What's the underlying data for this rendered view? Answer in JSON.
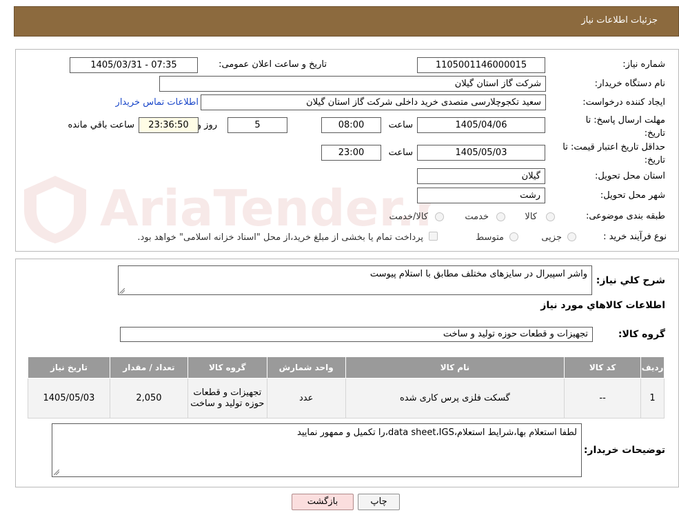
{
  "header": {
    "title": "جزئیات اطلاعات نیاز"
  },
  "watermark": {
    "text": "AriaTender.neT",
    "color": "#c0504d"
  },
  "form": {
    "need_number_label": "شماره نیاز:",
    "need_number": "1105001146000015",
    "announce_label": "تاریخ و ساعت اعلان عمومی:",
    "announce_value": "1405/03/31 - 07:35",
    "buyer_org_label": "نام دستگاه خریدار:",
    "buyer_org": "شرکت گاز استان گیلان",
    "requester_label": "ایجاد کننده درخواست:",
    "requester": "سعید تکجوچلارسی متصدی خرید داخلی شرکت گاز استان گیلان",
    "contact_link": "اطلاعات تماس خریدار",
    "reply_deadline_label": "مهلت ارسال پاسخ: تا تاریخ:",
    "reply_date": "1405/04/06",
    "time_label": "ساعت",
    "reply_time": "08:00",
    "days_value": "5",
    "days_label": "روز و",
    "remaining_time": "23:36:50",
    "remaining_label": "ساعت باقي مانده",
    "price_validity_label": "حداقل تاریخ اعتبار قیمت: تا تاریخ:",
    "price_date": "1405/05/03",
    "price_time": "23:00",
    "province_label": "استان محل تحویل:",
    "province": "گیلان",
    "city_label": "شهر محل تحویل:",
    "city": "رشت",
    "category_label": "طبقه بندی موضوعی:",
    "category_options": [
      "کالا",
      "خدمت",
      "کالا/خدمت"
    ],
    "process_label": "نوع فرآیند خرید :",
    "process_options": [
      "جزیی",
      "متوسط"
    ],
    "payment_note": "پرداخت تمام یا بخشی از مبلغ خرید،از محل \"اسناد خزانه اسلامی\" خواهد بود."
  },
  "details": {
    "summary_label": "شرح کلي نياز:",
    "summary": "واشر اسپیرال در سایزهای مختلف مطابق با استلام پیوست",
    "goods_info_title": "اطلاعات کالاهاي مورد نياز",
    "goods_group_label": "گروه کالا:",
    "goods_group": "تجهیزات و قطعات حوزه تولید و ساخت",
    "table": {
      "headers": [
        "ردیف",
        "کد کالا",
        "نام کالا",
        "واحد شمارش",
        "گروه کالا",
        "تعداد / مقدار",
        "تاریخ نیاز"
      ],
      "rows": [
        [
          "1",
          "--",
          "گسکت فلزی پرس کاری شده",
          "عدد",
          "تجهیزات و قطعات حوزه تولید و ساخت",
          "2,050",
          "1405/05/03"
        ]
      ]
    },
    "buyer_notes_label": "توضیحات خریدار:",
    "buyer_notes": "لطفا استعلام بها،شرایط استعلام،data sheet،IGS،را تکمیل و ممهور نمایید"
  },
  "buttons": {
    "print": "چاپ",
    "back": "بازگشت"
  }
}
